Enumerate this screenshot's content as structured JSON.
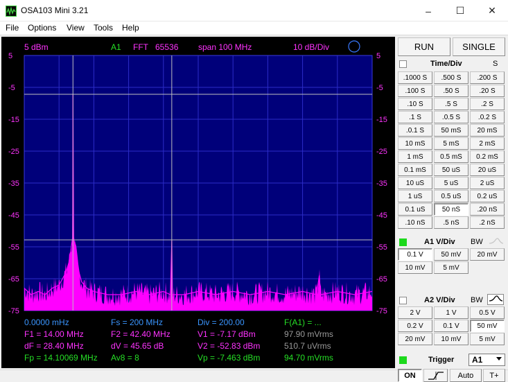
{
  "window": {
    "title": "OSA103 Mini 3.21",
    "minimize": "–",
    "maximize": "☐",
    "close": "✕"
  },
  "menu": [
    "File",
    "Options",
    "View",
    "Tools",
    "Help"
  ],
  "scope": {
    "header": {
      "ref_level": "5 dBm",
      "channel": "A1",
      "mode": "FFT",
      "points": "65536",
      "span": "span 100 MHz",
      "scale": "10 dB/Div"
    },
    "y_ticks_left": [
      "5",
      "-5",
      "-15",
      "-25",
      "-35",
      "-45",
      "-55",
      "-65",
      "-75"
    ],
    "y_ticks_right": [
      "5",
      "-5",
      "-15",
      "-25",
      "-35",
      "-45",
      "-55",
      "-65",
      "-75"
    ],
    "readouts": [
      {
        "text": "0.0000 mHz",
        "color": "#3a95ff"
      },
      {
        "text": "Fs = 200 MHz",
        "color": "#3a95ff"
      },
      {
        "text": "Div = 200.00",
        "color": "#3a95ff"
      },
      {
        "text": "F(A1) = ...",
        "color": "#26e026"
      },
      {
        "text": "F1 = 14.00 MHz",
        "color": "#ff33ff"
      },
      {
        "text": "F2 = 42.40 MHz",
        "color": "#ff33ff"
      },
      {
        "text": "V1 = -7.17 dBm",
        "color": "#ff33ff"
      },
      {
        "text": "97.90 mVrms",
        "color": "#9a9a9a"
      },
      {
        "text": "dF = 28.40 MHz",
        "color": "#ff33ff"
      },
      {
        "text": "dV = 45.65 dB",
        "color": "#ff33ff"
      },
      {
        "text": "V2 = -52.83 dBm",
        "color": "#ff33ff"
      },
      {
        "text": "510.7 uVrms",
        "color": "#9a9a9a"
      },
      {
        "text": "Fp = 14.10069 MHz",
        "color": "#26e026"
      },
      {
        "text": "Av8 = 8",
        "color": "#26e026"
      },
      {
        "text": "Vp = -7.463 dBm",
        "color": "#26e026"
      },
      {
        "text": "94.70 mVrms",
        "color": "#26e026"
      }
    ]
  },
  "chart_data": {
    "type": "line",
    "xlim": [
      0,
      100
    ],
    "ylim": [
      -75,
      5
    ],
    "grid": true,
    "series": [
      {
        "points": [
          [
            0,
            -68
          ],
          [
            2,
            -70
          ],
          [
            4,
            -69
          ],
          [
            6,
            -70
          ],
          [
            8,
            -68
          ],
          [
            10,
            -67
          ],
          [
            11,
            -65
          ],
          [
            12,
            -63
          ],
          [
            12.8,
            -60
          ],
          [
            13.4,
            -56
          ],
          [
            13.9,
            -52
          ],
          [
            14,
            -7
          ],
          [
            14.2,
            -52
          ],
          [
            14.8,
            -57
          ],
          [
            15.5,
            -62
          ],
          [
            16.5,
            -66
          ],
          [
            18,
            -68
          ],
          [
            20,
            -69
          ],
          [
            24,
            -70
          ],
          [
            28,
            -70
          ],
          [
            32,
            -69
          ],
          [
            36,
            -70
          ],
          [
            40,
            -69
          ],
          [
            42,
            -70
          ],
          [
            42.4,
            -53
          ],
          [
            42.6,
            -70
          ],
          [
            46,
            -70
          ],
          [
            50,
            -69
          ],
          [
            55,
            -70
          ],
          [
            60,
            -69
          ],
          [
            65,
            -70
          ],
          [
            70,
            -69
          ],
          [
            75,
            -70
          ],
          [
            80,
            -69
          ],
          [
            84,
            -70
          ],
          [
            84.8,
            -64
          ],
          [
            85.2,
            -70
          ],
          [
            90,
            -69
          ],
          [
            95,
            -70
          ],
          [
            100,
            -69
          ]
        ]
      }
    ],
    "markers": {
      "f1": 14.0,
      "f2": 42.4,
      "v1": -7.17,
      "v2": -52.83
    }
  },
  "panel": {
    "run": "RUN",
    "single": "SINGLE",
    "time_div": {
      "title": "Time/Div",
      "s": "S",
      "buttons": [
        ".1000 S",
        ".500 S",
        ".200 S",
        ".100 S",
        ".50 S",
        ".20 S",
        ".10 S",
        ".5 S",
        ".2 S",
        ".1 S",
        ".0.5 S",
        ".0.2 S",
        ".0.1 S",
        "50 mS",
        "20 mS",
        "10 mS",
        "5 mS",
        "2 mS",
        "1 mS",
        "0.5 mS",
        "0.2 mS",
        "0.1 mS",
        "50 uS",
        "20 uS",
        "10 uS",
        "5 uS",
        "2 uS",
        "1 uS",
        "0.5 uS",
        "0.2 uS",
        "0.1 uS",
        "50 nS",
        ".20 nS",
        ".10 nS",
        ".5 nS",
        ".2 nS"
      ],
      "selected": 31
    },
    "a1": {
      "title": "A1 V/Div",
      "bw": "BW",
      "buttons": [
        "0.1 V",
        "50 mV",
        "20 mV",
        "10 mV",
        "5 mV"
      ],
      "selected": 0
    },
    "a2": {
      "title": "A2 V/Div",
      "bw": "BW",
      "buttons": [
        "2 V",
        "1 V",
        "0.5 V",
        "0.2 V",
        "0.1 V",
        "50 mV",
        "20 mV",
        "10 mV",
        "5 mV"
      ],
      "selected": 5
    },
    "trigger": {
      "title": "Trigger",
      "source": "A1",
      "on": "ON",
      "auto": "Auto",
      "tplus": "T+"
    }
  },
  "colors": {
    "plot_bg": "#00007a",
    "grid": "#2c2cc8",
    "trace": "#ff00ff",
    "cursor": "#bfbfbf",
    "green": "#26e026",
    "blue": "#3a95ff",
    "magenta": "#ff33ff"
  },
  "icons": {
    "app": "oscilloscope-icon",
    "bw": "lowpass-curve-icon",
    "trigger_slope": "rising-edge-icon",
    "dropdown": "chevron-down-icon"
  }
}
